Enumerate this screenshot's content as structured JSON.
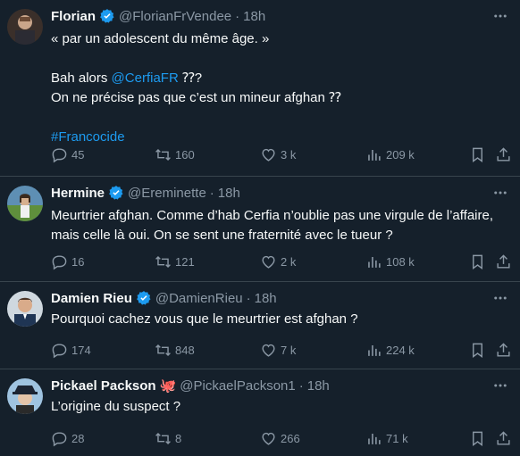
{
  "tweets": [
    {
      "name": "Florian",
      "handle": "@FlorianFrVendee",
      "time": "18h",
      "lines": [
        "« par un adolescent du même âge. »",
        "",
        "Bah alors ",
        "On ne précise pas que c’est un mineur afghan ⁇",
        "",
        "#Francocide"
      ],
      "mention": "@CerfiaFR",
      "after_mention": " ⁇?",
      "hashtag": "#Francocide",
      "replies": "45",
      "retweets": "160",
      "likes": "3 k",
      "views": "209 k",
      "verified_color": "#1d9bf0"
    },
    {
      "name": "Hermine",
      "handle": "@Ereminette",
      "time": "18h",
      "lines": [
        "Meurtrier afghan. Comme d’hab Cerfia n’oublie pas une virgule de l’affaire,",
        "mais celle là oui. On se sent une fraternité avec le tueur ?"
      ],
      "replies": "16",
      "retweets": "121",
      "likes": "2 k",
      "views": "108 k",
      "verified_color": "#1d9bf0"
    },
    {
      "name": "Damien Rieu",
      "handle": "@DamienRieu",
      "time": "18h",
      "lines": [
        "Pourquoi cachez vous que le meurtrier est afghan ?"
      ],
      "replies": "174",
      "retweets": "848",
      "likes": "7 k",
      "views": "224 k",
      "verified_color": "#1d9bf0"
    },
    {
      "name": "Pickael Packson",
      "handle": "@PickaelPackson1",
      "time": "18h",
      "lines": [
        "L’origine du suspect ?"
      ],
      "replies": "28",
      "retweets": "8",
      "likes": "266",
      "views": "71 k",
      "emoji": "🐙"
    }
  ],
  "separator": "·",
  "colors": {
    "background": "#15202b",
    "text": "#f7f9f9",
    "muted": "#8b98a5",
    "accent": "#1d9bf0",
    "border": "#38444d"
  }
}
